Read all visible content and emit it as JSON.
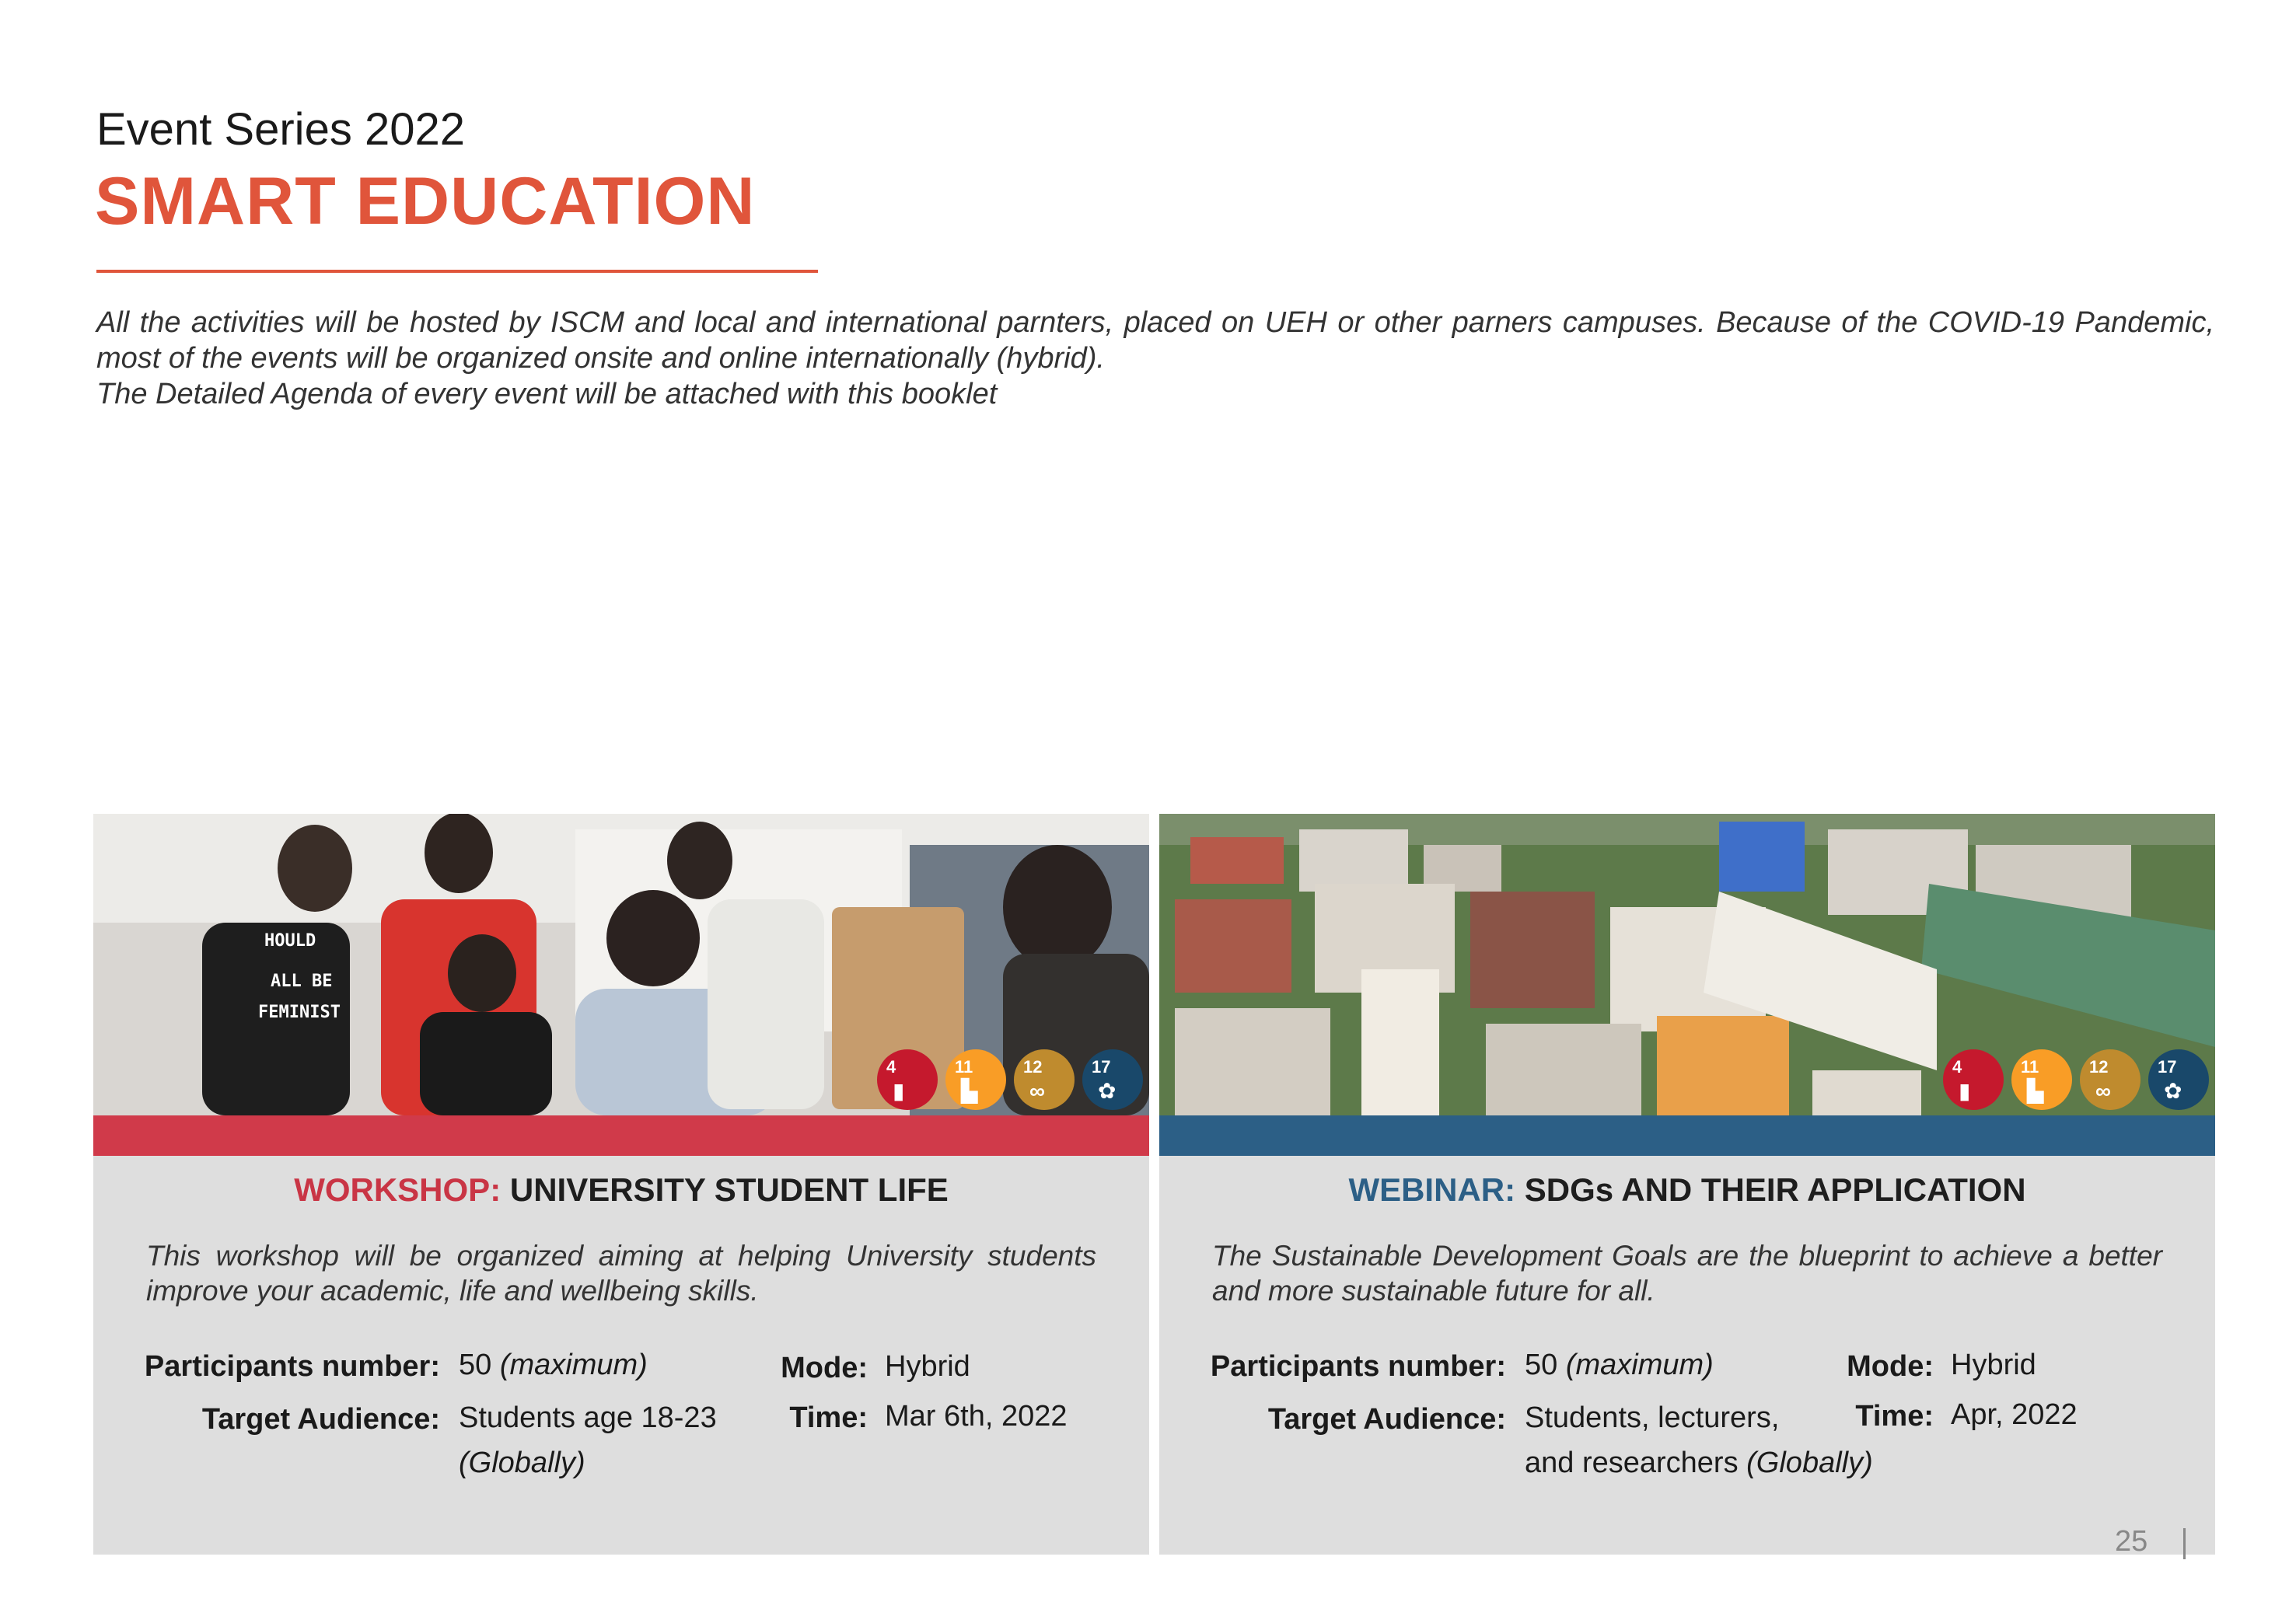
{
  "header": {
    "series": "Event Series 2022",
    "title": "SMART EDUCATION"
  },
  "intro": {
    "paragraph": "All the activities will be hosted by ISCM and local and international parnters, placed on UEH or other parners campuses. Because of the COVID-19 Pandemic, most of the events will be organized onsite and online internationally (hybrid).",
    "agenda_note": "The Detailed Agenda of every event will be attached with this booklet"
  },
  "events": [
    {
      "kind": "WORKSHOP:",
      "title": "UNIVERSITY STUDENT LIFE",
      "description": "This workshop will be organized aiming at helping University students improve your academic, life and wellbeing skills.",
      "participants_label": "Participants number:",
      "participants_value": "50",
      "participants_note": "(maximum)",
      "audience_label": "Target Audience:",
      "audience_line1": "Students age 18-23",
      "audience_line2_plain": "",
      "audience_line2_italic": "(Globally)",
      "mode_label": "Mode:",
      "mode_value": "Hybrid",
      "time_label": "Time:",
      "time_value": "Mar 6th, 2022",
      "band_color": "#d03a4a"
    },
    {
      "kind": "WEBINAR:",
      "title": "SDGs AND THEIR APPLICATION",
      "description": "The Sustainable Development Goals are the blueprint to achieve a better and more sustainable future for all.",
      "participants_label": "Participants number:",
      "participants_value": "50",
      "participants_note": "(maximum)",
      "audience_label": "Target Audience:",
      "audience_line1": "Students, lecturers,",
      "audience_line2_plain": "and researchers",
      "audience_line2_italic": "(Globally)",
      "mode_label": "Mode:",
      "mode_value": "Hybrid",
      "time_label": "Time:",
      "time_value": "Apr, 2022",
      "band_color": "#2c5f86"
    }
  ],
  "sdg_badges": [
    {
      "number": "4",
      "color": "#c5192d",
      "icon": "book-icon"
    },
    {
      "number": "11",
      "color": "#f99d26",
      "icon": "city-icon"
    },
    {
      "number": "12",
      "color": "#bf8b2e",
      "icon": "infinity-icon"
    },
    {
      "number": "17",
      "color": "#19486a",
      "icon": "flower-icon"
    }
  ],
  "colors": {
    "accent": "#e0553b",
    "workshop": "#c93545",
    "webinar": "#2c5f86",
    "card_bg": "#dedede"
  },
  "footer": {
    "page_number": "25"
  }
}
